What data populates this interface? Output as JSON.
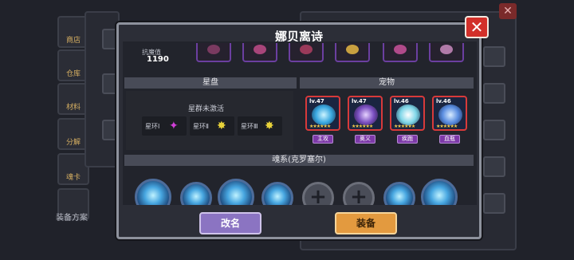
{
  "side_menu": {
    "items": [
      {
        "label": "商店",
        "icon": "shop-icon"
      },
      {
        "label": "仓库",
        "icon": "warehouse-icon"
      },
      {
        "label": "材料",
        "icon": "materials-icon"
      },
      {
        "label": "分解",
        "icon": "dismantle-icon"
      },
      {
        "label": "魂卡",
        "icon": "soul-card-icon"
      }
    ],
    "loadout_label": "装备方案"
  },
  "dialog": {
    "title": "娜贝离诗",
    "close_label": "✕",
    "resist_label": "抗魔值",
    "resist_value": "1190",
    "sections": {
      "star_disk": "星盘",
      "pets": "宠物",
      "soul_system": "魂系(克罗塞尔)"
    },
    "star_inactive": "星群未激活",
    "rings": [
      {
        "label": "星环Ⅰ",
        "icon": "✦",
        "color": "#d13fd8"
      },
      {
        "label": "星环Ⅱ",
        "icon": "✸",
        "color": "#e8d23a"
      },
      {
        "label": "星环Ⅲ",
        "icon": "✸",
        "color": "#e8d23a"
      }
    ],
    "pets": [
      {
        "level": "lv.47",
        "tag": "主攻",
        "art": "#3aa8e0"
      },
      {
        "level": "lv.47",
        "tag": "奥义",
        "art": "#7a4fc0"
      },
      {
        "level": "lv.46",
        "tag": "疾跑",
        "art": "#7fd6e8"
      },
      {
        "level": "lv.46",
        "tag": "血瓶",
        "art": "#5a8de0"
      }
    ],
    "pet_stars": "★★★★★★",
    "soul_empty_glyph": "+",
    "buttons": {
      "rename": "改名",
      "equip": "装备"
    }
  },
  "background": {
    "close_glyph": "✕"
  }
}
